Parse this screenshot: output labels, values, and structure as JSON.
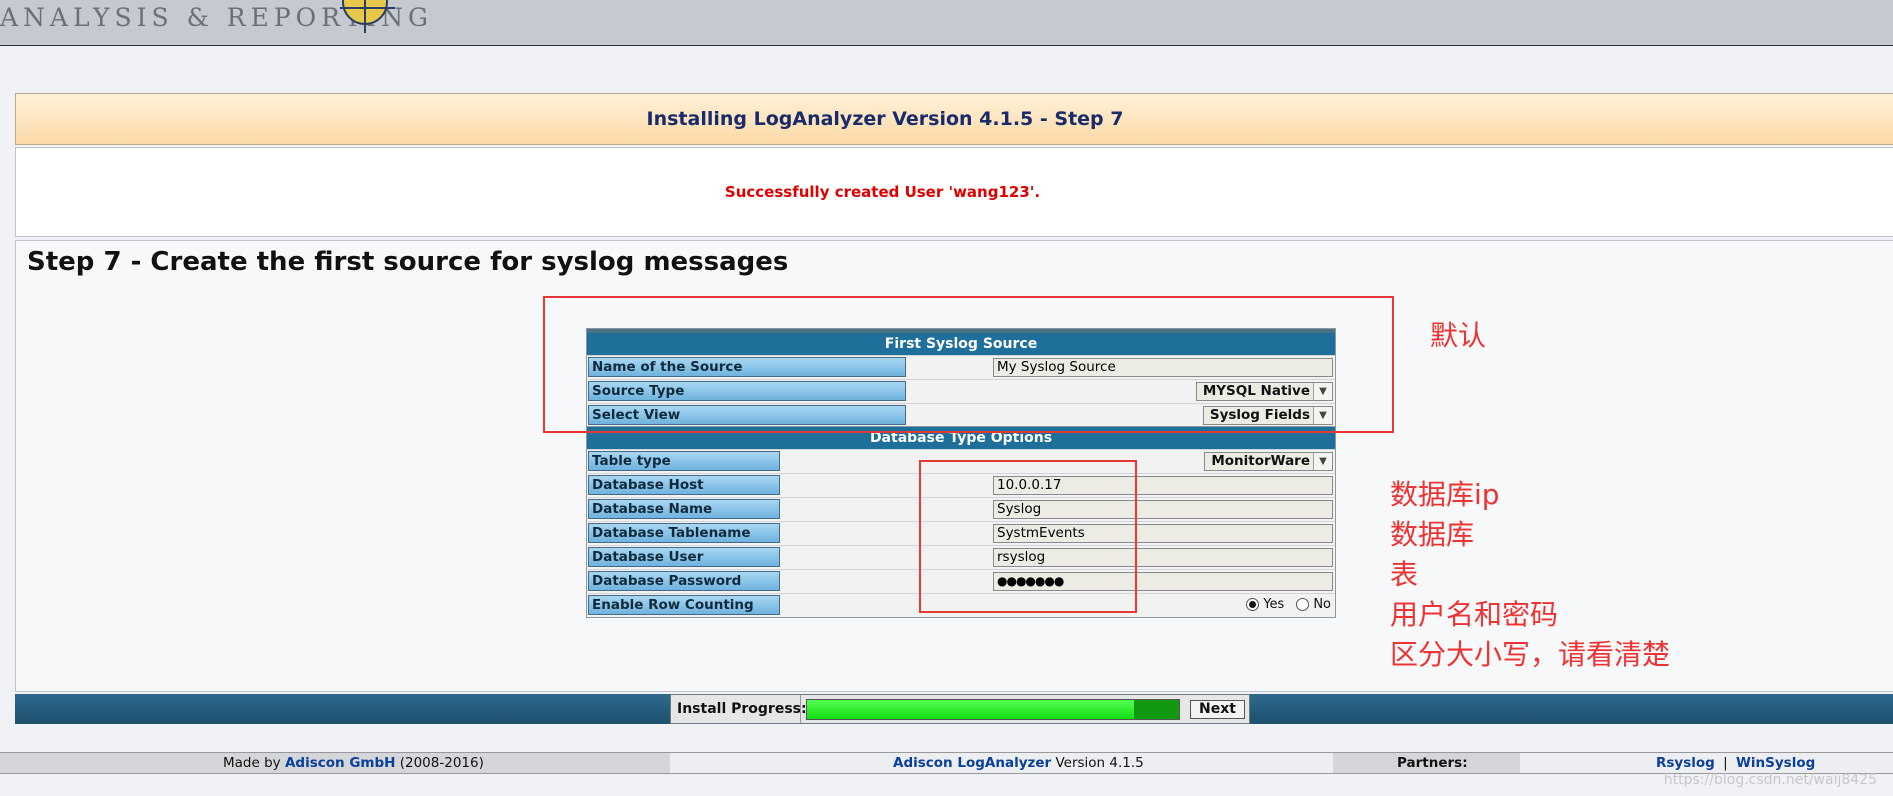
{
  "header": {
    "logo_text": "ANALYSIS & REPORTING"
  },
  "page_title": "Installing LogAnalyzer Version 4.1.5 - Step 7",
  "message": "Successfully created User 'wang123'.",
  "step_heading": "Step 7 - Create the first source for syslog messages",
  "source_section": {
    "title": "First Syslog Source",
    "rows": [
      {
        "label": "Name of the Source",
        "value": "My Syslog Source"
      },
      {
        "label": "Source Type",
        "value": "MYSQL Native"
      },
      {
        "label": "Select View",
        "value": "Syslog Fields"
      }
    ]
  },
  "db_section": {
    "title": "Database Type Options",
    "table_type": {
      "label": "Table type",
      "value": "MonitorWare"
    },
    "fields": [
      {
        "label": "Database Host",
        "value": "10.0.0.17"
      },
      {
        "label": "Database Name",
        "value": "Syslog"
      },
      {
        "label": "Database Tablename",
        "value": "SystmEvents"
      },
      {
        "label": "Database User",
        "value": "rsyslog"
      },
      {
        "label": "Database Password",
        "value": "●●●●●●●"
      }
    ],
    "row_counting": {
      "label": "Enable Row Counting",
      "yes": "Yes",
      "no": "No",
      "selected": "Yes"
    }
  },
  "annotations": {
    "default": "默认",
    "lines": [
      "数据库ip",
      "数据库",
      "表",
      "用户名和密码",
      "区分大小写，请看清楚"
    ]
  },
  "progress": {
    "label": "Install Progress:",
    "percent": 88,
    "next_label": "Next"
  },
  "footer": {
    "made_by_prefix": "Made by",
    "company_link": "Adiscon GmbH",
    "years": "(2008-2016)",
    "product_link": "Adiscon LogAnalyzer",
    "version": "Version 4.1.5",
    "partners_label": "Partners:",
    "partner1": "Rsyslog",
    "separator": "|",
    "partner2": "WinSyslog"
  },
  "watermark": "https://blog.csdn.net/waij8425"
}
